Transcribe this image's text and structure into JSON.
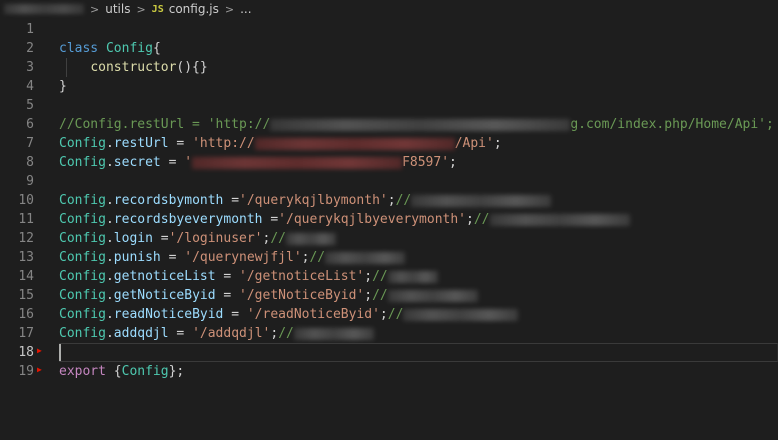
{
  "breadcrumb": {
    "folder": "utils",
    "file": "config.js",
    "more": "...",
    "file_icon": "JS"
  },
  "editor": {
    "lines": [
      {
        "n": "1",
        "tokens": []
      },
      {
        "n": "2",
        "tokens": [
          {
            "t": "kw",
            "v": "class "
          },
          {
            "t": "cls",
            "v": "Config"
          },
          {
            "t": "pun",
            "v": "{"
          }
        ]
      },
      {
        "n": "3",
        "tokens": [
          {
            "t": "pun",
            "v": "    "
          },
          {
            "t": "fn",
            "v": "constructor"
          },
          {
            "t": "pun",
            "v": "(){}"
          }
        ]
      },
      {
        "n": "4",
        "tokens": [
          {
            "t": "pun",
            "v": "}"
          }
        ]
      },
      {
        "n": "5",
        "tokens": []
      },
      {
        "n": "6",
        "tokens": [
          {
            "t": "cmt",
            "v": "//Config.restUrl = 'http://"
          },
          {
            "t": "blur",
            "w": 300
          },
          {
            "t": "cmt",
            "v": "g.com/index.php/Home/Api';"
          }
        ]
      },
      {
        "n": "7",
        "tokens": [
          {
            "t": "cls",
            "v": "Config"
          },
          {
            "t": "pun",
            "v": "."
          },
          {
            "t": "prop",
            "v": "restUrl"
          },
          {
            "t": "pun",
            "v": " = "
          },
          {
            "t": "str",
            "v": "'http://"
          },
          {
            "t": "blur",
            "w": 200,
            "red": true
          },
          {
            "t": "str",
            "v": "/Api'"
          },
          {
            "t": "pun",
            "v": ";"
          }
        ]
      },
      {
        "n": "8",
        "tokens": [
          {
            "t": "cls",
            "v": "Config"
          },
          {
            "t": "pun",
            "v": "."
          },
          {
            "t": "prop",
            "v": "secret"
          },
          {
            "t": "pun",
            "v": " = "
          },
          {
            "t": "str",
            "v": "'"
          },
          {
            "t": "blur",
            "w": 210,
            "red": true
          },
          {
            "t": "str",
            "v": "F8597'"
          },
          {
            "t": "pun",
            "v": ";"
          }
        ]
      },
      {
        "n": "9",
        "tokens": []
      },
      {
        "n": "10",
        "tokens": [
          {
            "t": "cls",
            "v": "Config"
          },
          {
            "t": "pun",
            "v": "."
          },
          {
            "t": "prop",
            "v": "recordsbymonth"
          },
          {
            "t": "pun",
            "v": " ="
          },
          {
            "t": "str",
            "v": "'/querykqjlbymonth'"
          },
          {
            "t": "pun",
            "v": ";"
          },
          {
            "t": "cmt",
            "v": "//"
          },
          {
            "t": "blur",
            "w": 140
          }
        ]
      },
      {
        "n": "11",
        "tokens": [
          {
            "t": "cls",
            "v": "Config"
          },
          {
            "t": "pun",
            "v": "."
          },
          {
            "t": "prop",
            "v": "recordsbyeverymonth"
          },
          {
            "t": "pun",
            "v": " ="
          },
          {
            "t": "str",
            "v": "'/querykqjlbyeverymonth'"
          },
          {
            "t": "pun",
            "v": ";"
          },
          {
            "t": "cmt",
            "v": "//"
          },
          {
            "t": "blur",
            "w": 140
          }
        ]
      },
      {
        "n": "12",
        "tokens": [
          {
            "t": "cls",
            "v": "Config"
          },
          {
            "t": "pun",
            "v": "."
          },
          {
            "t": "prop",
            "v": "login"
          },
          {
            "t": "pun",
            "v": " ="
          },
          {
            "t": "str",
            "v": "'/loginuser'"
          },
          {
            "t": "pun",
            "v": ";"
          },
          {
            "t": "cmt",
            "v": "//"
          },
          {
            "t": "blur",
            "w": 50
          }
        ]
      },
      {
        "n": "13",
        "tokens": [
          {
            "t": "cls",
            "v": "Config"
          },
          {
            "t": "pun",
            "v": "."
          },
          {
            "t": "prop",
            "v": "punish"
          },
          {
            "t": "pun",
            "v": " = "
          },
          {
            "t": "str",
            "v": "'/querynewjfjl'"
          },
          {
            "t": "pun",
            "v": ";"
          },
          {
            "t": "cmt",
            "v": "//"
          },
          {
            "t": "blur",
            "w": 80
          }
        ]
      },
      {
        "n": "14",
        "tokens": [
          {
            "t": "cls",
            "v": "Config"
          },
          {
            "t": "pun",
            "v": "."
          },
          {
            "t": "prop",
            "v": "getnoticeList"
          },
          {
            "t": "pun",
            "v": " = "
          },
          {
            "t": "str",
            "v": "'/getnoticeList'"
          },
          {
            "t": "pun",
            "v": ";"
          },
          {
            "t": "cmt",
            "v": "//"
          },
          {
            "t": "blur",
            "w": 50
          }
        ]
      },
      {
        "n": "15",
        "tokens": [
          {
            "t": "cls",
            "v": "Config"
          },
          {
            "t": "pun",
            "v": "."
          },
          {
            "t": "prop",
            "v": "getNoticeByid"
          },
          {
            "t": "pun",
            "v": " = "
          },
          {
            "t": "str",
            "v": "'/getNoticeByid'"
          },
          {
            "t": "pun",
            "v": ";"
          },
          {
            "t": "cmt",
            "v": "//"
          },
          {
            "t": "blur",
            "w": 90
          }
        ]
      },
      {
        "n": "16",
        "tokens": [
          {
            "t": "cls",
            "v": "Config"
          },
          {
            "t": "pun",
            "v": "."
          },
          {
            "t": "prop",
            "v": "readNoticeByid"
          },
          {
            "t": "pun",
            "v": " = "
          },
          {
            "t": "str",
            "v": "'/readNoticeByid'"
          },
          {
            "t": "pun",
            "v": ";"
          },
          {
            "t": "cmt",
            "v": "//"
          },
          {
            "t": "blur",
            "w": 115
          }
        ]
      },
      {
        "n": "17",
        "tokens": [
          {
            "t": "cls",
            "v": "Config"
          },
          {
            "t": "pun",
            "v": "."
          },
          {
            "t": "prop",
            "v": "addqdjl"
          },
          {
            "t": "pun",
            "v": " = "
          },
          {
            "t": "str",
            "v": "'/addqdjl'"
          },
          {
            "t": "pun",
            "v": ";"
          },
          {
            "t": "cmt",
            "v": "//"
          },
          {
            "t": "blur",
            "w": 80
          }
        ]
      },
      {
        "n": "18",
        "tokens": [],
        "current": true
      },
      {
        "n": "19",
        "tokens": [
          {
            "t": "kw2",
            "v": "export "
          },
          {
            "t": "pun",
            "v": "{"
          },
          {
            "t": "cls",
            "v": "Config"
          },
          {
            "t": "pun",
            "v": "};"
          }
        ]
      }
    ]
  },
  "colors": {
    "background": "#1e1e1e",
    "keyword": "#569cd6",
    "class": "#4ec9b0",
    "string": "#ce9178",
    "property": "#9cdcfe",
    "comment": "#6a9955"
  }
}
